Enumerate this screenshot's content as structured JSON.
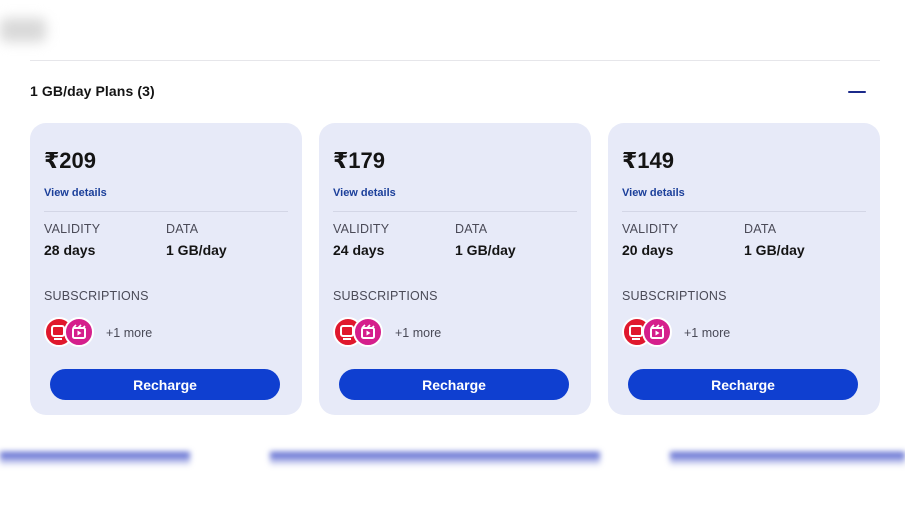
{
  "section": {
    "title": "1 GB/day Plans (3)"
  },
  "plans": [
    {
      "price": "₹209",
      "view_details": "View details",
      "validity_label": "VALIDITY",
      "validity": "28 days",
      "data_label": "DATA",
      "data": "1 GB/day",
      "subscriptions_label": "SUBSCRIPTIONS",
      "more": "+1 more",
      "button": "Recharge"
    },
    {
      "price": "₹179",
      "view_details": "View details",
      "validity_label": "VALIDITY",
      "validity": "24 days",
      "data_label": "DATA",
      "data": "1 GB/day",
      "subscriptions_label": "SUBSCRIPTIONS",
      "more": "+1 more",
      "button": "Recharge"
    },
    {
      "price": "₹149",
      "view_details": "View details",
      "validity_label": "VALIDITY",
      "validity": "20 days",
      "data_label": "DATA",
      "data": "1 GB/day",
      "subscriptions_label": "SUBSCRIPTIONS",
      "more": "+1 more",
      "button": "Recharge"
    }
  ],
  "icons": {
    "collapse": "minus-icon",
    "subscription_1": "jiotv-icon",
    "subscription_2": "jiocinema-icon"
  },
  "colors": {
    "card_bg": "#e7eaf8",
    "button_bg": "#0f3fd0",
    "link": "#1b3f9a",
    "icon_red": "#e0182d",
    "icon_pink": "#d51f8c"
  }
}
